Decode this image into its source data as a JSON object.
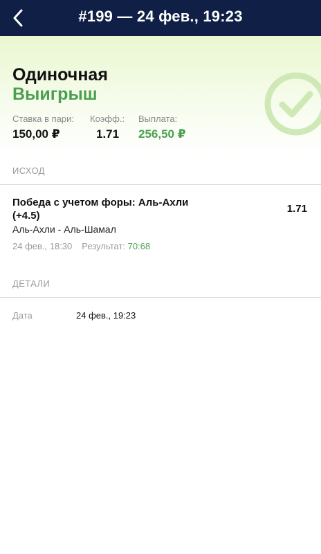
{
  "header": {
    "title": "#199 — 24 фев., 19:23"
  },
  "bet": {
    "type": "Одиночная",
    "status": "Выигрыш",
    "stake_label": "Ставка в пари:",
    "stake_value": "150,00 ₽",
    "odds_label": "Коэфф.:",
    "odds_value": "1.71",
    "payout_label": "Выплата:",
    "payout_value": "256,50 ₽"
  },
  "outcome": {
    "section_title": "ИСХОД",
    "selection": "Победа с учетом форы: Аль-Ахли (+4.5)",
    "odds": "1.71",
    "match": "Аль-Ахли - Аль-Шамал",
    "datetime": "24 фев., 18:30",
    "result_label": "Результат:",
    "result_value": "70:68"
  },
  "details": {
    "section_title": "ДЕТАЛИ",
    "date_label": "Дата",
    "date_value": "24 фев., 19:23"
  },
  "icons": {
    "back": "chevron-left-icon",
    "status": "check-circle-icon"
  },
  "colors": {
    "header_bg": "#0f1f45",
    "win_green": "#4aa04f",
    "badge_green": "#cfe9b6"
  }
}
